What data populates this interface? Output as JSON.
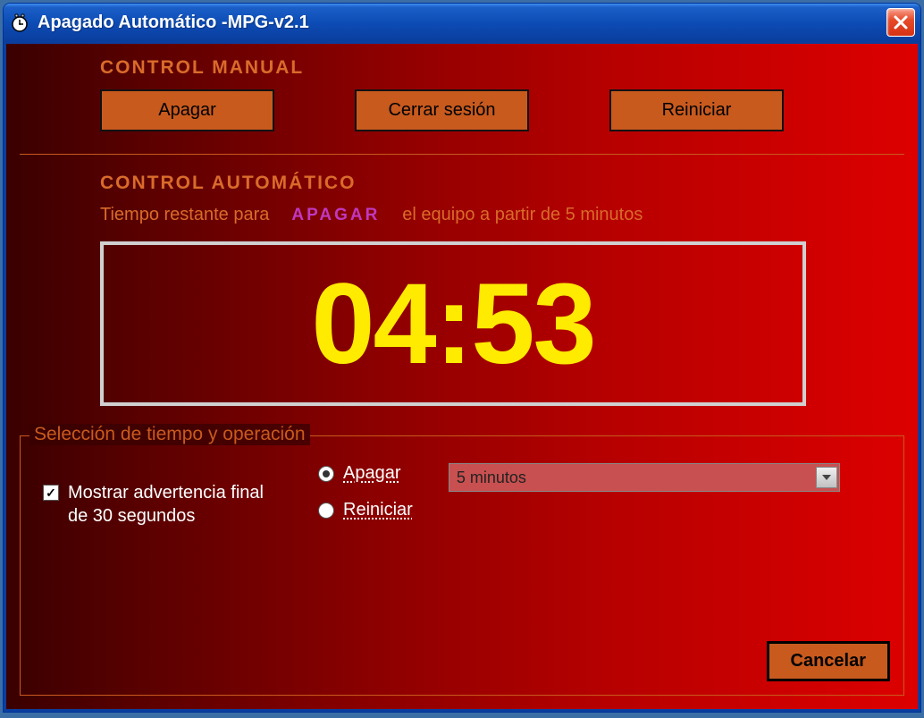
{
  "window": {
    "title": "Apagado Automático -MPG-v2.1"
  },
  "manual": {
    "title": "CONTROL MANUAL",
    "buttons": {
      "shutdown": "Apagar",
      "logoff": "Cerrar sesión",
      "restart": "Reiniciar"
    }
  },
  "auto": {
    "title": "CONTROL AUTOMÁTICO",
    "desc_before": "Tiempo restante para",
    "desc_action": "APAGAR",
    "desc_after": "el equipo a partir de 5 minutos",
    "timer": "04:53"
  },
  "selection": {
    "legend": "Selección de tiempo y operación",
    "warning_checkbox_label": "Mostrar advertencia final de 30 segundos",
    "warning_checked": true,
    "radio_shutdown": "Apagar",
    "radio_restart": "Reiniciar",
    "radio_selected": "shutdown",
    "dropdown_value": "5 minutos",
    "cancel": "Cancelar"
  }
}
